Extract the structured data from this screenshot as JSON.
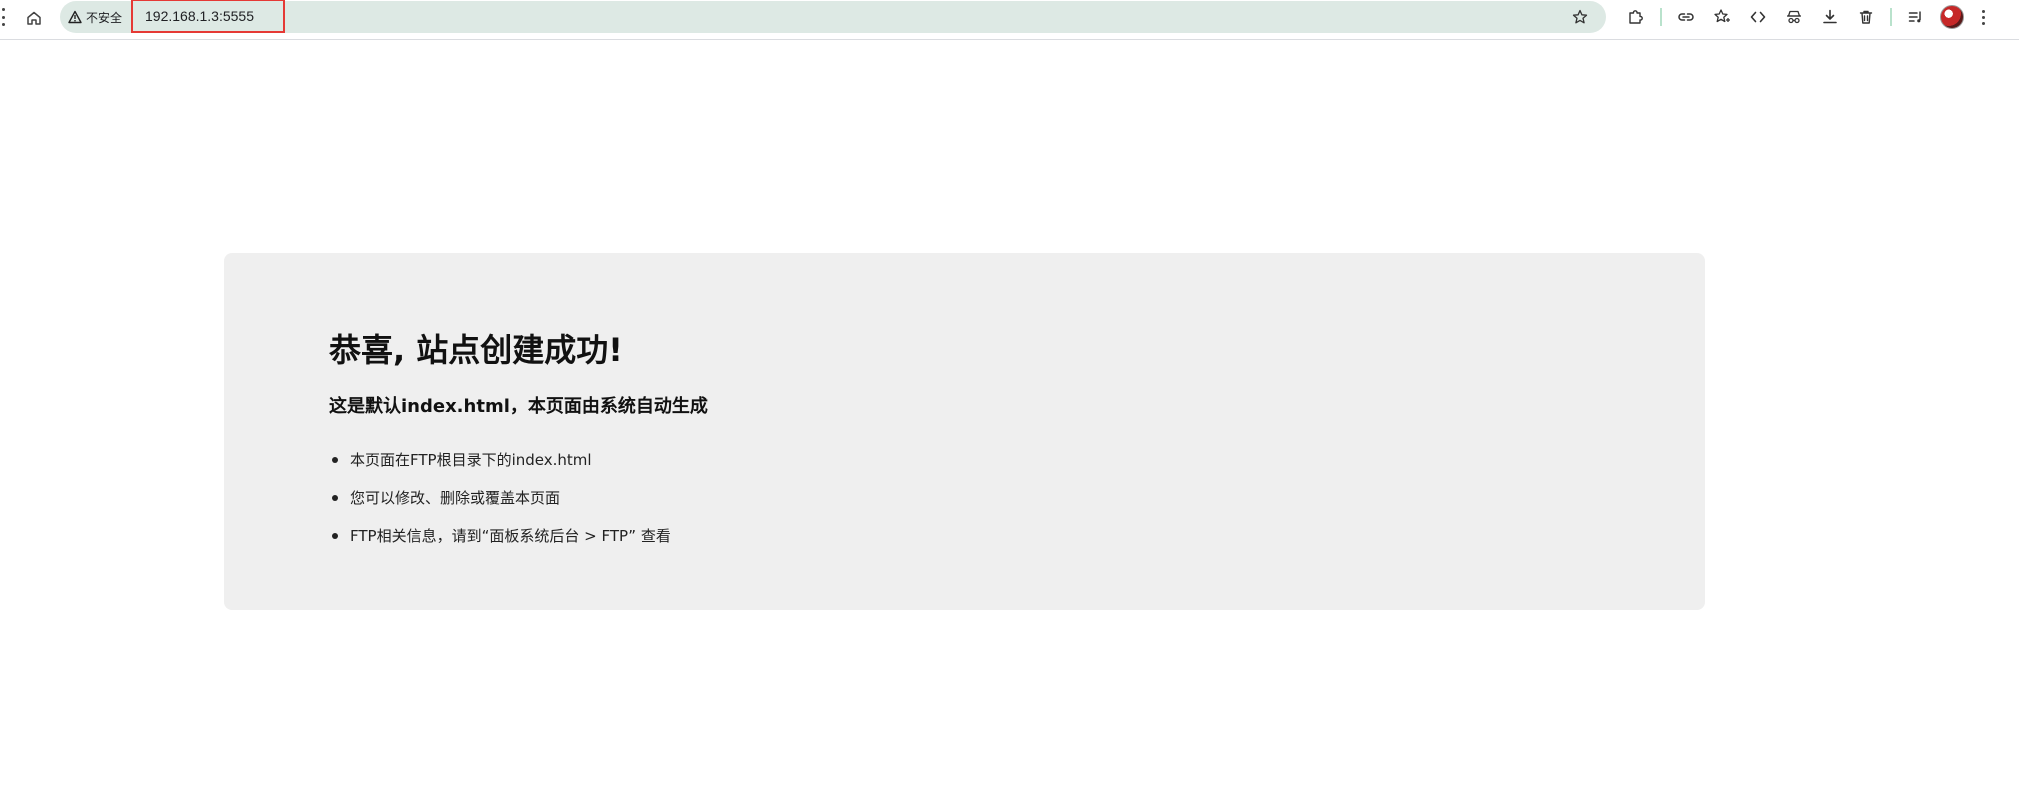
{
  "browser": {
    "security_label": "不安全",
    "url": "192.168.1.3:5555",
    "icons": {
      "home": "home-icon",
      "warning": "warning-icon",
      "bookmark": "star-outline-icon",
      "extensions": "puzzle-icon",
      "link": "link-icon",
      "favorites": "favorites-icon",
      "devtools": "code-icon",
      "incognito": "spy-icon",
      "download": "download-icon",
      "delete": "trash-icon",
      "media": "media-queue-icon",
      "profile": "avatar",
      "menu": "kebab-menu-icon"
    },
    "colors": {
      "omnibox_bg": "#dde9e4",
      "highlight_box": "#e53935"
    }
  },
  "page": {
    "title": "恭喜, 站点创建成功!",
    "subtitle": "这是默认index.html，本页面由系统自动生成",
    "bullets": [
      "本页面在FTP根目录下的index.html",
      "您可以修改、删除或覆盖本页面",
      "FTP相关信息，请到“面板系统后台 > FTP” 查看"
    ],
    "card_bg": "#efefef"
  }
}
